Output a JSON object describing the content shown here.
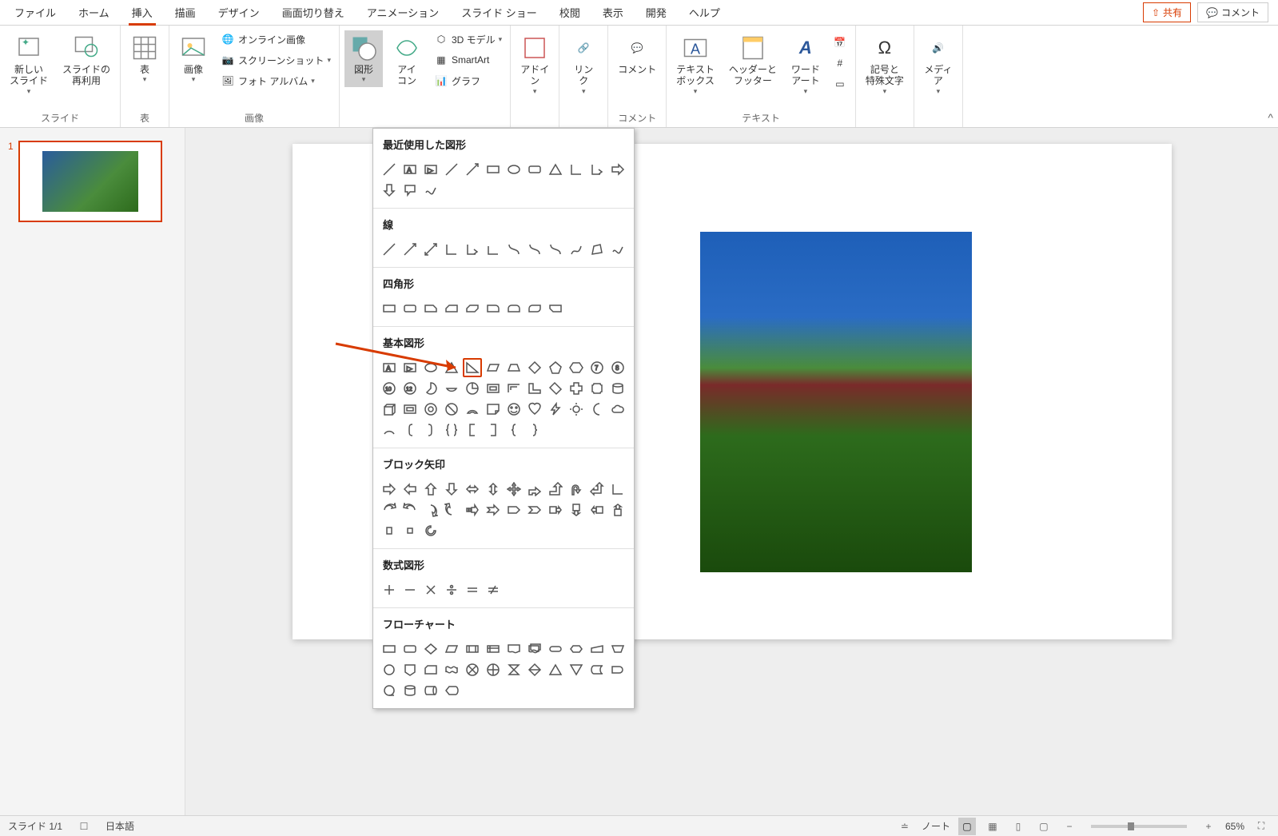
{
  "tabs": {
    "file": "ファイル",
    "home": "ホーム",
    "insert": "挿入",
    "draw": "描画",
    "design": "デザイン",
    "transition": "画面切り替え",
    "animation": "アニメーション",
    "slideshow": "スライド ショー",
    "review": "校閲",
    "view": "表示",
    "developer": "開発",
    "help": "ヘルプ",
    "share": "共有",
    "comment": "コメント"
  },
  "ribbon": {
    "groups": {
      "slides": {
        "label": "スライド",
        "new_slide": "新しい\nスライド",
        "reuse": "スライドの\n再利用"
      },
      "tables": {
        "label": "表",
        "table": "表"
      },
      "images": {
        "label": "画像",
        "picture": "画像",
        "online": "オンライン画像",
        "screenshot": "スクリーンショット",
        "album": "フォト アルバム"
      },
      "illustrations": {
        "shapes": "図形",
        "icons": "アイ\nコン",
        "model3d": "3D モデル",
        "smartart": "SmartArt",
        "chart": "グラフ"
      },
      "addins": {
        "addin": "アドイ\nン"
      },
      "links": {
        "link": "リン\nク"
      },
      "comments": {
        "label": "コメント",
        "comment": "コメント"
      },
      "text": {
        "label": "テキスト",
        "textbox": "テキスト\nボックス",
        "header": "ヘッダーと\nフッター",
        "wordart": "ワード\nアート"
      },
      "symbols": {
        "label": "記号と\n特殊文字"
      },
      "media": {
        "label": "メディ\nア"
      }
    }
  },
  "shapes_dd": {
    "sections": {
      "recent": "最近使用した図形",
      "lines": "線",
      "rectangles": "四角形",
      "basic": "基本図形",
      "block_arrows": "ブロック矢印",
      "equation": "数式図形",
      "flowchart": "フローチャート"
    }
  },
  "thumbs": {
    "slide1_num": "1"
  },
  "status": {
    "slide_indicator": "スライド 1/1",
    "language": "日本語",
    "notes": "ノート",
    "zoom": "65%"
  }
}
